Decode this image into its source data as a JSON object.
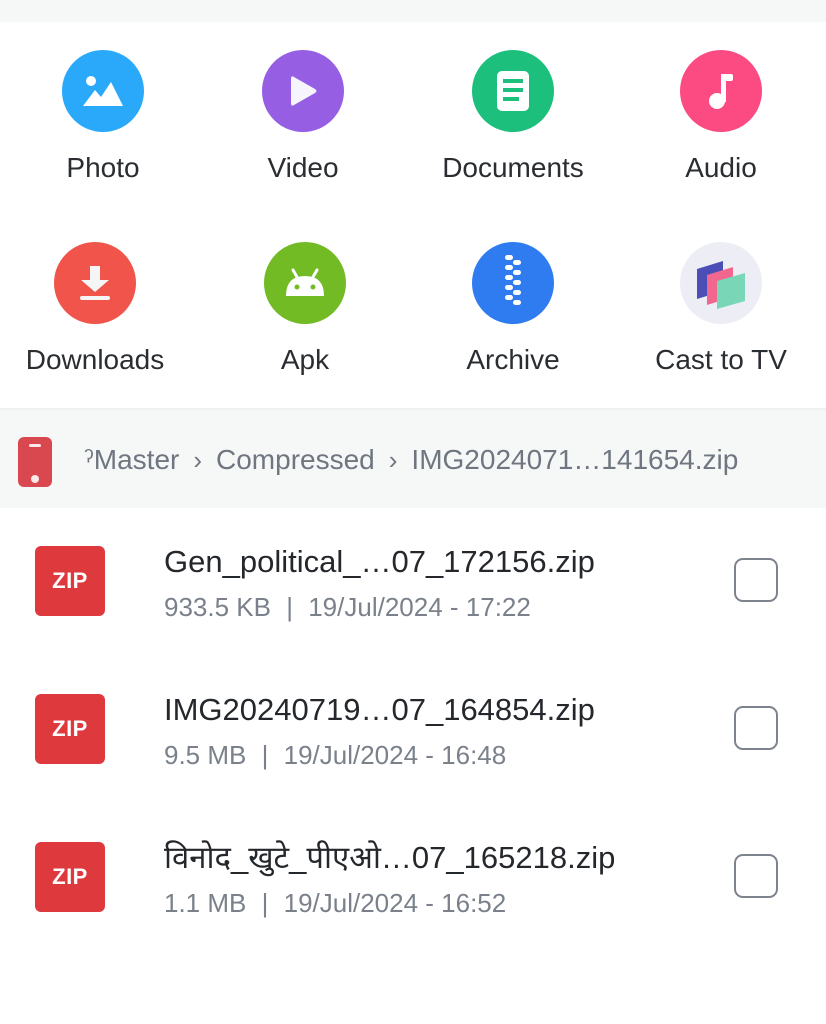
{
  "categories": [
    {
      "label": "Photo",
      "icon": "image-icon",
      "color": "#2aa9fb"
    },
    {
      "label": "Video",
      "icon": "play-icon",
      "color": "#965ee3"
    },
    {
      "label": "Documents",
      "icon": "document-icon",
      "color": "#1cbf7c"
    },
    {
      "label": "Audio",
      "icon": "music-note-icon",
      "color": "#fb4b82"
    },
    {
      "label": "Downloads",
      "icon": "download-icon",
      "color": "#f0544a"
    },
    {
      "label": "Apk",
      "icon": "android-icon",
      "color": "#72bb24"
    },
    {
      "label": "Archive",
      "icon": "zipper-icon",
      "color": "#2f7cf0"
    },
    {
      "label": "Cast to TV",
      "icon": "cast-screens-icon",
      "color": "#ededf6"
    }
  ],
  "breadcrumb": {
    "root_icon": "phone-storage-icon",
    "items": [
      "ˀMaster",
      "Compressed",
      "IMG2024071…141654.zip"
    ],
    "separator": "›"
  },
  "files": [
    {
      "icon_label": "ZIP",
      "name": "Gen_political_…07_172156.zip",
      "size": "933.5 KB",
      "date": "19/Jul/2024 - 17:22",
      "checked": false
    },
    {
      "icon_label": "ZIP",
      "name": "IMG20240719…07_164854.zip",
      "size": "9.5 MB",
      "date": "19/Jul/2024 - 16:48",
      "checked": false
    },
    {
      "icon_label": "ZIP",
      "name": "विनोद_खुटे_पीएओ…07_165218.zip",
      "size": "1.1 MB",
      "date": "19/Jul/2024 - 16:52",
      "checked": false
    }
  ],
  "meta_separator": "|"
}
